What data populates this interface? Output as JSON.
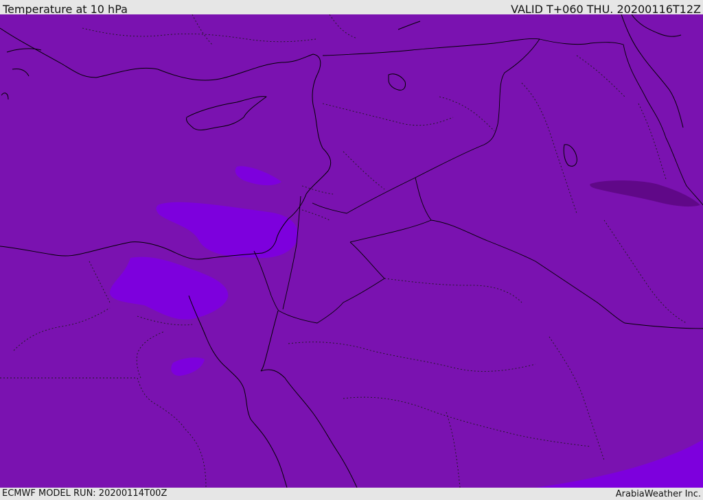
{
  "header": {
    "title": "Temperature at 10 hPa",
    "valid": "VALID T+060 THU. 20200116T12Z"
  },
  "footer": {
    "model_run": "ECMWF MODEL RUN: 20200114T00Z",
    "credit": "ArabiaWeather Inc."
  },
  "colors": {
    "base_field": "#7a12b0",
    "warmer_patch": "#7d00dd",
    "colder_patch": "#600888",
    "lines": "#000000"
  }
}
